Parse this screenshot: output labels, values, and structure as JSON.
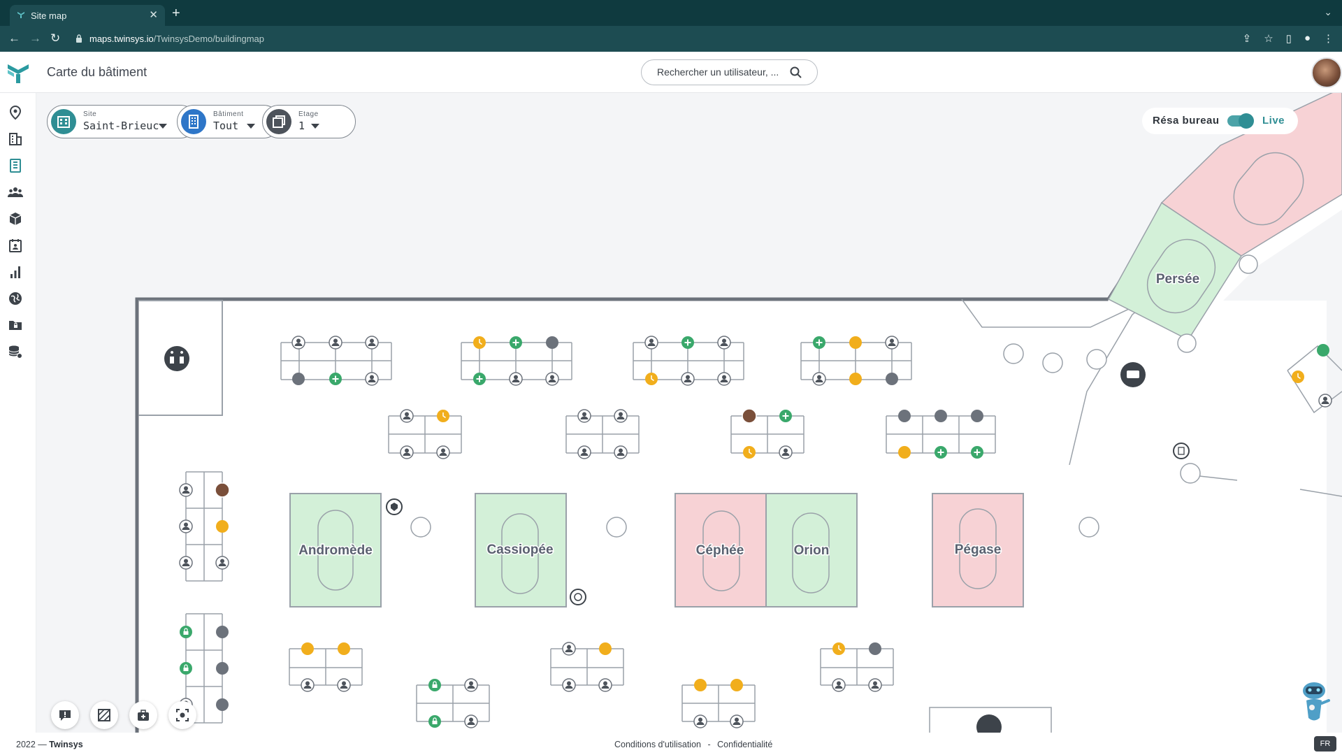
{
  "browser": {
    "tab_title": "Site map",
    "url_host": "maps.twinsys.io",
    "url_path": "/TwinsysDemo/buildingmap"
  },
  "header": {
    "title": "Carte du bâtiment",
    "search_placeholder": "Rechercher un utilisateur, ..."
  },
  "sidebar": {
    "items": [
      "location-icon",
      "building-icon",
      "floor-plan-icon",
      "people-icon",
      "box-icon",
      "calendar-icon",
      "stats-icon",
      "globe-icon",
      "folder-icon",
      "database-icon"
    ]
  },
  "filters": {
    "site": {
      "label": "Site",
      "value": "Saint-Brieuc"
    },
    "building": {
      "label": "Bâtiment",
      "value": "Tout"
    },
    "floor": {
      "label": "Etage",
      "value": "1"
    }
  },
  "resa": {
    "label": "Résa bureau",
    "live_label": "Live",
    "enabled": true
  },
  "rooms": [
    {
      "name": "Andromède",
      "status": "free"
    },
    {
      "name": "Cassiopée",
      "status": "free"
    },
    {
      "name": "Céphée",
      "status": "occupied"
    },
    {
      "name": "Orion",
      "status": "free"
    },
    {
      "name": "Pégase",
      "status": "occupied"
    },
    {
      "name": "Persée",
      "status": "free"
    }
  ],
  "colors": {
    "free_room": "#d3f0d8",
    "occupied_room": "#f7d2d5",
    "pending": "#f1ae1c",
    "available": "#3aa86b",
    "occupied_seat": "#6c727b",
    "accent": "#2f8e94"
  },
  "footer": {
    "copyright_year": "2022 —",
    "copyright_brand": "Twinsys",
    "terms": "Conditions d'utilisation",
    "privacy": "Confidentialité",
    "separator": "-",
    "lang": "FR"
  }
}
